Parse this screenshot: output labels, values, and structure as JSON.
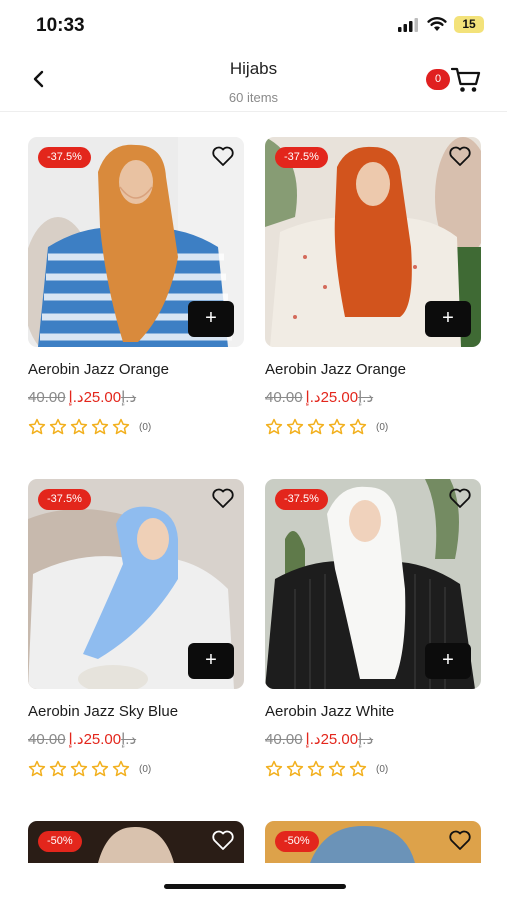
{
  "status_bar": {
    "time": "10:33",
    "battery": "15"
  },
  "header": {
    "title": "Hijabs",
    "subtitle": "60 items",
    "cart_count": "0"
  },
  "products": [
    {
      "name": "Aerobin Jazz Orange",
      "old_price": "40.00د.إ",
      "new_price": "25.00د.إ",
      "discount": "-37.5%",
      "rating_count": "(0)",
      "scarf_color": "#d98a3c",
      "shirt_color": "#3d7fc4",
      "bg_color": "#ececec"
    },
    {
      "name": "Aerobin Jazz Orange",
      "old_price": "40.00د.إ",
      "new_price": "25.00د.إ",
      "discount": "-37.5%",
      "rating_count": "(0)",
      "scarf_color": "#d2541d",
      "shirt_color": "#f1ece4",
      "bg_color": "#e8e2da"
    },
    {
      "name": "Aerobin Jazz Sky Blue",
      "old_price": "40.00د.إ",
      "new_price": "25.00د.إ",
      "discount": "-37.5%",
      "rating_count": "(0)",
      "scarf_color": "#8fbcef",
      "shirt_color": "#efefef",
      "bg_color": "#d8d2cc"
    },
    {
      "name": "Aerobin Jazz White",
      "old_price": "40.00د.إ",
      "new_price": "25.00د.إ",
      "discount": "-37.5%",
      "rating_count": "(0)",
      "scarf_color": "#f7f7f5",
      "shirt_color": "#1d1d1d",
      "bg_color": "#c9cdc4"
    },
    {
      "discount": "-50%",
      "scarf_color": "#d9c2ae",
      "shirt_color": "#3a2a22",
      "bg_color": "#2a1d16"
    },
    {
      "discount": "-50%",
      "scarf_color": "#6b93b8",
      "shirt_color": "#c98c3a",
      "bg_color": "#dda24a"
    }
  ],
  "colors": {
    "sale_red": "#e3261c",
    "star_gold": "#f2b01e"
  },
  "icons": {
    "back": "chevron-left-icon",
    "cart": "shopping-cart-icon",
    "favorite": "heart-outline-icon",
    "add": "plus-icon",
    "star": "star-outline-icon"
  }
}
